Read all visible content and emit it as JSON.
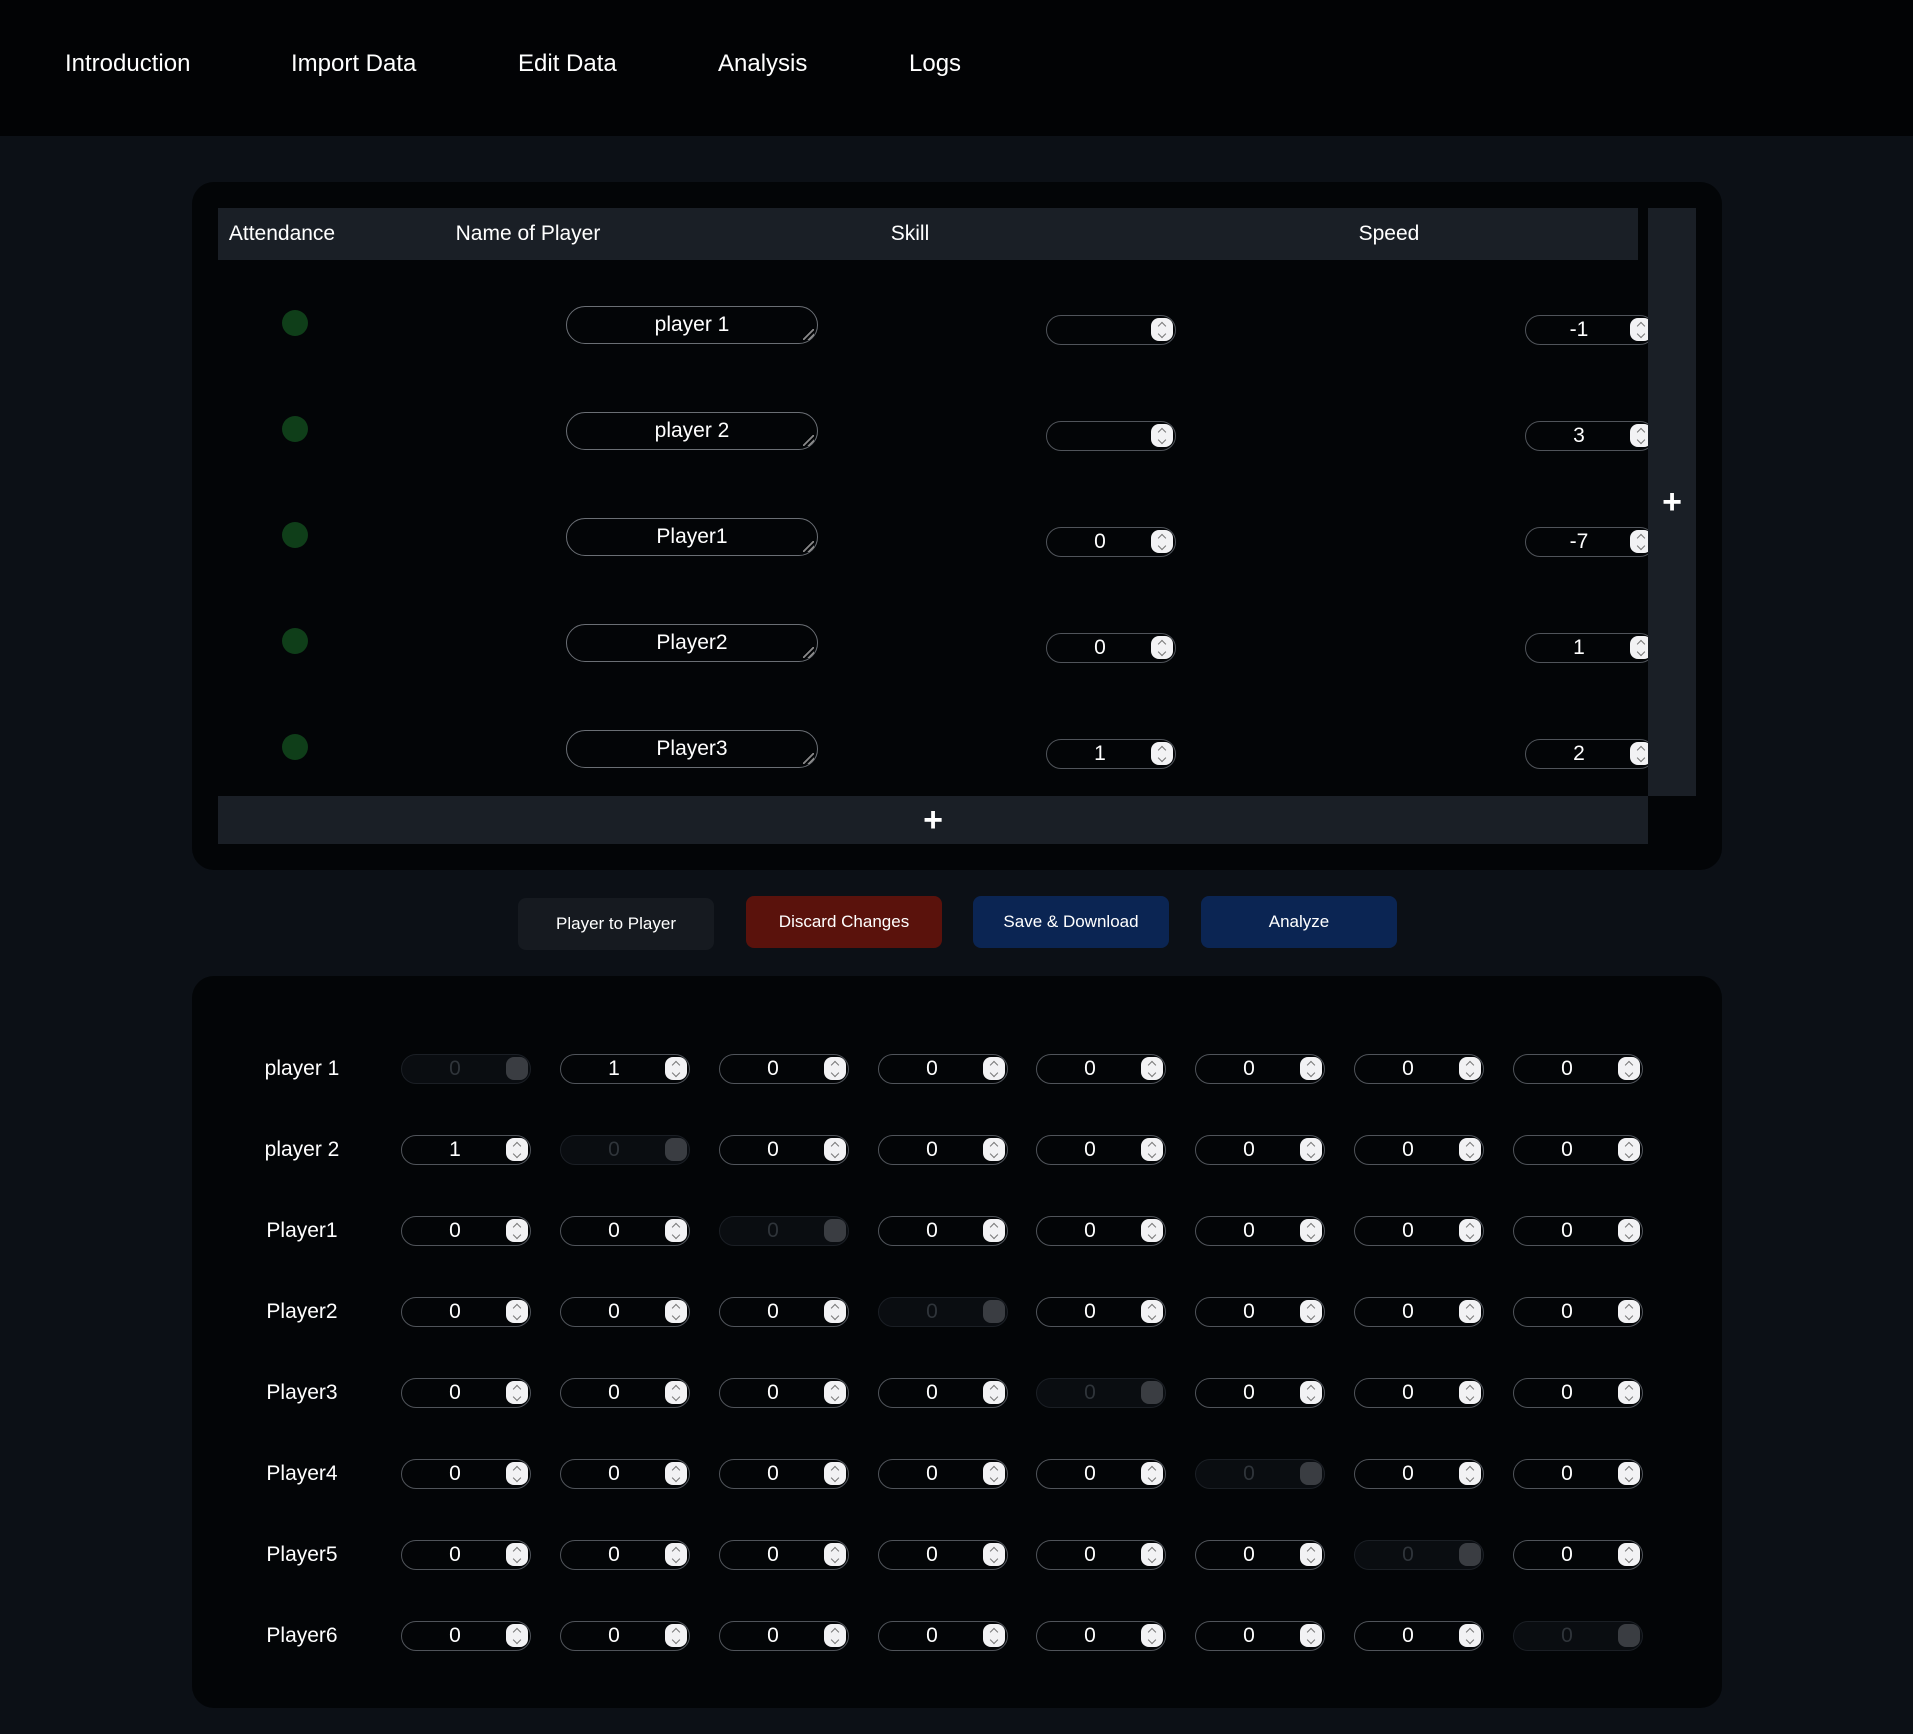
{
  "nav": [
    "Introduction",
    "Import Data",
    "Edit Data",
    "Analysis",
    "Logs"
  ],
  "table": {
    "headers": [
      "Attendance",
      "Name of Player",
      "Skill",
      "Speed"
    ],
    "rows": [
      {
        "name": "player 1",
        "skill": "",
        "speed": "-1"
      },
      {
        "name": "player 2",
        "skill": "",
        "speed": "3"
      },
      {
        "name": "Player1",
        "skill": "0",
        "speed": "-7"
      },
      {
        "name": "Player2",
        "skill": "0",
        "speed": "1"
      },
      {
        "name": "Player3",
        "skill": "1",
        "speed": "2"
      }
    ],
    "add_symbol": "+"
  },
  "buttons": {
    "player_to_player": "Player to Player",
    "discard": "Discard Changes",
    "save": "Save & Download",
    "analyze": "Analyze"
  },
  "colors": {
    "attendance_dot": "#0f3e19",
    "discard_bg": "#5a120c",
    "primary_bg": "#0b2553"
  },
  "matrix": {
    "players": [
      "player 1",
      "player 2",
      "Player1",
      "Player2",
      "Player3",
      "Player4",
      "Player5",
      "Player6"
    ],
    "values": [
      [
        "0",
        "1",
        "0",
        "0",
        "0",
        "0",
        "0",
        "0"
      ],
      [
        "1",
        "0",
        "0",
        "0",
        "0",
        "0",
        "0",
        "0"
      ],
      [
        "0",
        "0",
        "0",
        "0",
        "0",
        "0",
        "0",
        "0"
      ],
      [
        "0",
        "0",
        "0",
        "0",
        "0",
        "0",
        "0",
        "0"
      ],
      [
        "0",
        "0",
        "0",
        "0",
        "0",
        "0",
        "0",
        "0"
      ],
      [
        "0",
        "0",
        "0",
        "0",
        "0",
        "0",
        "0",
        "0"
      ],
      [
        "0",
        "0",
        "0",
        "0",
        "0",
        "0",
        "0",
        "0"
      ],
      [
        "0",
        "0",
        "0",
        "0",
        "0",
        "0",
        "0",
        "0"
      ]
    ]
  }
}
